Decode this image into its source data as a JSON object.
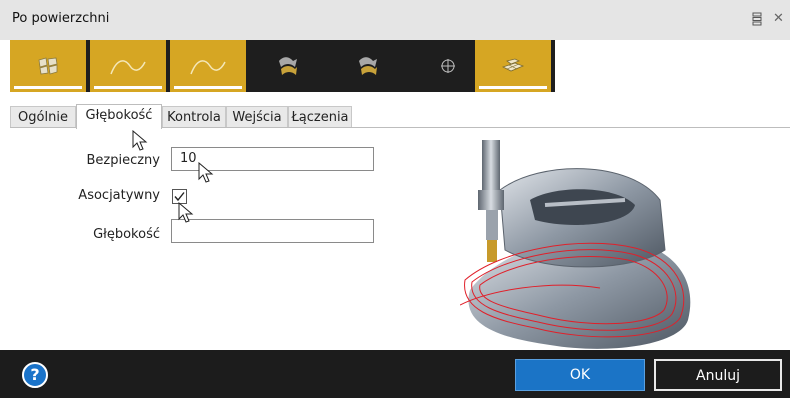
{
  "window": {
    "title": "Po powierzchni"
  },
  "toolbar": {
    "tools": [
      {
        "icon": "surfaces-icon",
        "active": true
      },
      {
        "icon": "curve-icon",
        "active": true
      },
      {
        "icon": "curve-icon",
        "active": true
      },
      {
        "icon": "stacked-surfaces-icon",
        "active": false
      },
      {
        "icon": "stacked-surfaces-icon",
        "active": false
      },
      {
        "icon": "crosshair-icon",
        "active": false
      },
      {
        "icon": "grid-plane-icon",
        "active": true
      }
    ]
  },
  "tabs": [
    {
      "label": "Ogólnie",
      "active": false
    },
    {
      "label": "Głębokość",
      "active": true
    },
    {
      "label": "Kontrola",
      "active": false
    },
    {
      "label": "Wejścia",
      "active": false
    },
    {
      "label": "Łączenia",
      "active": false
    }
  ],
  "form": {
    "safe_label": "Bezpieczny",
    "safe_value": "10",
    "assoc_label": "Asocjatywny",
    "assoc_checked": true,
    "depth_label": "Głębokość",
    "depth_value": ""
  },
  "footer": {
    "help_glyph": "?",
    "ok_label": "OK",
    "cancel_label": "Anuluj"
  },
  "colors": {
    "accent": "#d6a623",
    "toolbar_bg": "#1e1e1e",
    "ok_button": "#1b74c6",
    "footer_bg": "#1c1c1c",
    "toolpath": "#e0202a"
  }
}
